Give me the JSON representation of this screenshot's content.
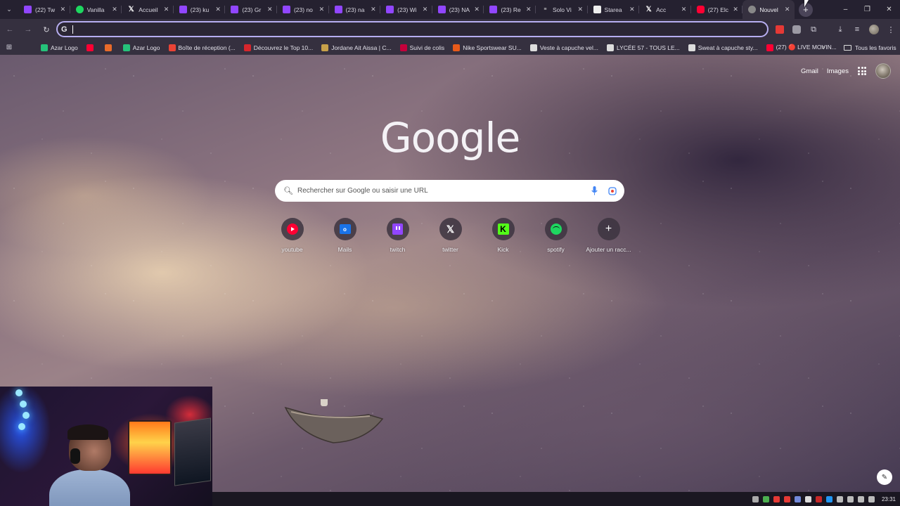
{
  "tabs": [
    {
      "title": "(22) Tw",
      "favicon": "twitch"
    },
    {
      "title": "Vanilla",
      "favicon": "spotify"
    },
    {
      "title": "Accueil",
      "favicon": "x"
    },
    {
      "title": "(23) ku",
      "favicon": "twitch"
    },
    {
      "title": "(23) Gr",
      "favicon": "twitch"
    },
    {
      "title": "(23) no",
      "favicon": "twitch"
    },
    {
      "title": "(23) na",
      "favicon": "twitch"
    },
    {
      "title": "(23) Wi",
      "favicon": "twitch"
    },
    {
      "title": "(23) NA",
      "favicon": "twitch"
    },
    {
      "title": "(23) Re",
      "favicon": "twitch"
    },
    {
      "title": "Solo Vi",
      "favicon": "solo"
    },
    {
      "title": "Starea",
      "favicon": "starea"
    },
    {
      "title": "Acc",
      "favicon": "x"
    },
    {
      "title": "(27) Elc",
      "favicon": "yt"
    },
    {
      "title": "Nouvel",
      "favicon": "chrome",
      "active": true
    }
  ],
  "window": {
    "new_tab": "+",
    "minimize": "–",
    "restore": "❐",
    "close": "✕"
  },
  "toolbar": {
    "back": "←",
    "forward": "→",
    "reload": "↻",
    "omnibox_icon": "G",
    "omnibox_value": "",
    "download": "⤓",
    "media": "≡",
    "menu": "⋮",
    "extensions": "⧉"
  },
  "bookmarks": [
    {
      "label": "Azar Logo",
      "color": "#25c27a"
    },
    {
      "label": "",
      "color": "#ff0033"
    },
    {
      "label": "",
      "color": "#e96b2a"
    },
    {
      "label": "Azar Logo",
      "color": "#25c27a"
    },
    {
      "label": "Boîte de réception (...",
      "color": "#ea4335"
    },
    {
      "label": "Découvrez le Top 10...",
      "color": "#d6262c"
    },
    {
      "label": "Jordane Ait Aissa | C...",
      "color": "#c7a14a"
    },
    {
      "label": "Suivi de colis",
      "color": "#c4003b"
    },
    {
      "label": "Nike Sportswear SU...",
      "color": "#e85a1a"
    },
    {
      "label": "Veste à capuche vel...",
      "color": "#dddddd"
    },
    {
      "label": "LYCÉE 57 - TOUS LE...",
      "color": "#dddddd"
    },
    {
      "label": "Sweat à capuche sty...",
      "color": "#dddddd"
    },
    {
      "label": "(27) 🔴 LIVE MOVIN...",
      "color": "#ff0033"
    }
  ],
  "bookmarks_more": "»",
  "bookmarks_folder": "Tous les favoris",
  "ntp": {
    "gmail": "Gmail",
    "images": "Images",
    "logo": "Google",
    "search_placeholder": "Rechercher sur Google ou saisir une URL",
    "shortcuts": [
      {
        "label": "youtube",
        "icon": "youtube-icon"
      },
      {
        "label": "Mails",
        "icon": "mail-icon"
      },
      {
        "label": "twitch",
        "icon": "twitch-icon"
      },
      {
        "label": "twitter",
        "icon": "x-icon"
      },
      {
        "label": "Kick",
        "icon": "kick-icon"
      },
      {
        "label": "spotify",
        "icon": "spotify-icon"
      },
      {
        "label": "Ajouter un racc...",
        "icon": "plus-icon"
      }
    ],
    "customize_icon": "✎"
  },
  "taskbar": {
    "clock": "23:31"
  }
}
